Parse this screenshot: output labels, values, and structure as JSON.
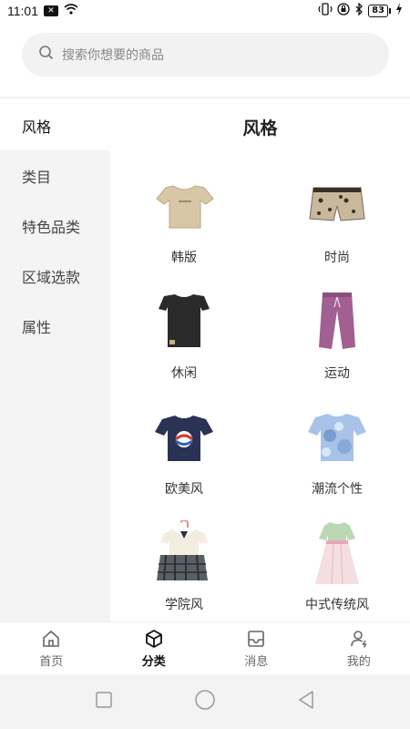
{
  "status_bar": {
    "time": "11:01",
    "notif_badge": "✕",
    "battery": "83"
  },
  "search": {
    "placeholder": "搜索你想要的商品"
  },
  "sidebar": {
    "items": [
      {
        "label": "风格",
        "active": true
      },
      {
        "label": "类目"
      },
      {
        "label": "特色品类"
      },
      {
        "label": "区域选款"
      },
      {
        "label": "属性"
      }
    ]
  },
  "main": {
    "title": "风格",
    "items": [
      {
        "label": "韩版",
        "icon": "beige-tshirt-icon"
      },
      {
        "label": "时尚",
        "icon": "leopard-shorts-icon"
      },
      {
        "label": "休闲",
        "icon": "black-tshirt-icon"
      },
      {
        "label": "运动",
        "icon": "purple-pants-icon"
      },
      {
        "label": "欧美风",
        "icon": "navy-graphic-tee-icon"
      },
      {
        "label": "潮流个性",
        "icon": "tiedye-shirt-icon"
      },
      {
        "label": "学院风",
        "icon": "school-uniform-icon"
      },
      {
        "label": "中式传统风",
        "icon": "hanfu-dress-icon"
      }
    ]
  },
  "tabbar": {
    "tabs": [
      {
        "label": "首页",
        "icon": "home-icon"
      },
      {
        "label": "分类",
        "icon": "cube-icon",
        "active": true
      },
      {
        "label": "消息",
        "icon": "inbox-icon"
      },
      {
        "label": "我的",
        "icon": "user-icon"
      }
    ]
  },
  "colors": {
    "sidebar_bg": "#f4f4f4",
    "search_bg": "#f2f2f2",
    "sysnav_bg": "#f3f3f3"
  }
}
